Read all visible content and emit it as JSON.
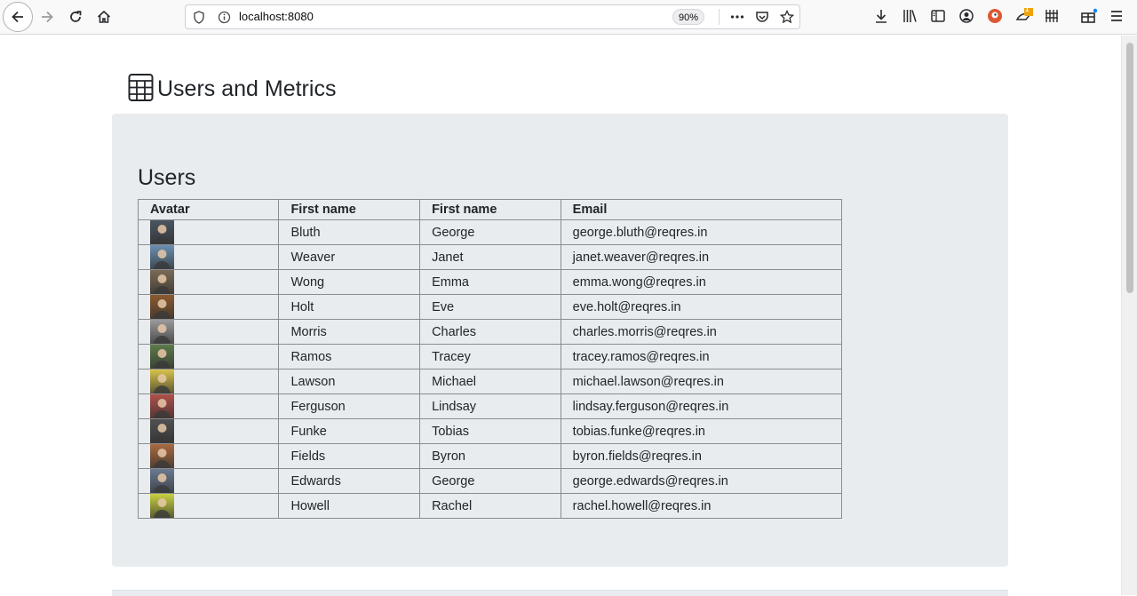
{
  "browser": {
    "url": "localhost:8080",
    "zoom": "90%",
    "notification_badge": "1",
    "accent": "#0a84ff"
  },
  "page": {
    "title": "Users and Metrics",
    "card_background": "#e9ecef"
  },
  "users": {
    "heading": "Users",
    "columns": [
      "Avatar",
      "First name",
      "First name",
      "Email"
    ],
    "rows": [
      {
        "last": "Bluth",
        "first": "George",
        "email": "george.bluth@reqres.in",
        "avatar_color": "#4a5560"
      },
      {
        "last": "Weaver",
        "first": "Janet",
        "email": "janet.weaver@reqres.in",
        "avatar_color": "#6a8fb0"
      },
      {
        "last": "Wong",
        "first": "Emma",
        "email": "emma.wong@reqres.in",
        "avatar_color": "#7a6a55"
      },
      {
        "last": "Holt",
        "first": "Eve",
        "email": "eve.holt@reqres.in",
        "avatar_color": "#8a5a30"
      },
      {
        "last": "Morris",
        "first": "Charles",
        "email": "charles.morris@reqres.in",
        "avatar_color": "#9a9a9a"
      },
      {
        "last": "Ramos",
        "first": "Tracey",
        "email": "tracey.ramos@reqres.in",
        "avatar_color": "#5d7a4a"
      },
      {
        "last": "Lawson",
        "first": "Michael",
        "email": "michael.lawson@reqres.in",
        "avatar_color": "#d8c24a"
      },
      {
        "last": "Ferguson",
        "first": "Lindsay",
        "email": "lindsay.ferguson@reqres.in",
        "avatar_color": "#b0504a"
      },
      {
        "last": "Funke",
        "first": "Tobias",
        "email": "tobias.funke@reqres.in",
        "avatar_color": "#505050"
      },
      {
        "last": "Fields",
        "first": "Byron",
        "email": "byron.fields@reqres.in",
        "avatar_color": "#a86a40"
      },
      {
        "last": "Edwards",
        "first": "George",
        "email": "george.edwards@reqres.in",
        "avatar_color": "#6a7a90"
      },
      {
        "last": "Howell",
        "first": "Rachel",
        "email": "rachel.howell@reqres.in",
        "avatar_color": "#c8d040"
      }
    ]
  }
}
